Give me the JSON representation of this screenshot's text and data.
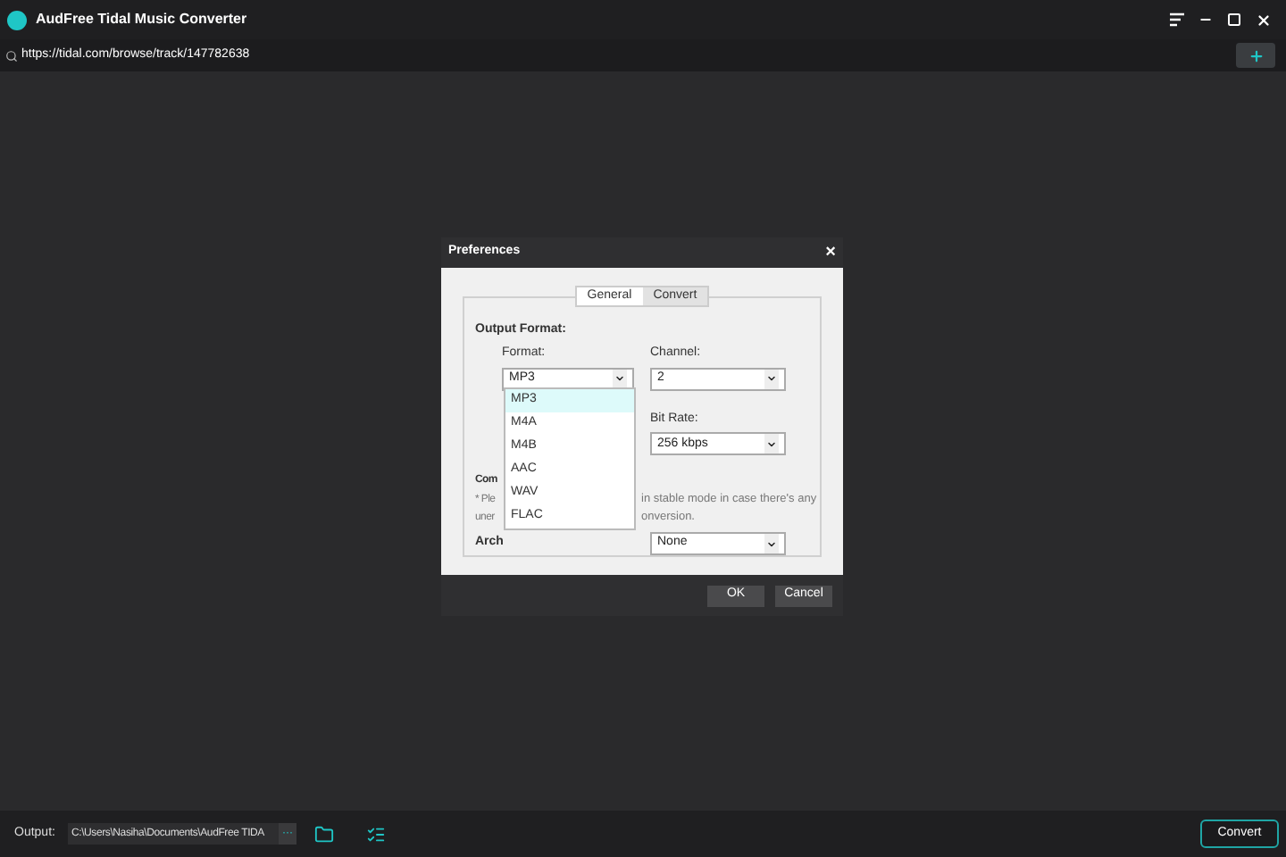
{
  "window": {
    "title": "AudFree Tidal Music Converter"
  },
  "address_bar": {
    "value": "https://tidal.com/browse/track/147782638"
  },
  "dialog": {
    "title": "Preferences",
    "close": "×",
    "tabs": [
      {
        "label": "General",
        "selected": false
      },
      {
        "label": "Convert",
        "selected": true
      }
    ],
    "section_heading": "Output Format:",
    "format": {
      "label": "Format:",
      "value": "MP3",
      "expanded": true,
      "options": [
        {
          "label": "MP3",
          "selected": true
        },
        {
          "label": "M4A",
          "selected": false
        },
        {
          "label": "M4B",
          "selected": false
        },
        {
          "label": "AAC",
          "selected": false
        },
        {
          "label": "WAV",
          "selected": false
        },
        {
          "label": "FLAC",
          "selected": false
        }
      ]
    },
    "channel": {
      "label": "Channel:",
      "value": "2"
    },
    "bit_rate": {
      "label": "Bit Rate:",
      "value": "256 kbps"
    },
    "compat_heading": "Com",
    "note_lines": [
      {
        "left": "* Ple",
        "right": "in stable mode in case there's any"
      },
      {
        "left": "uner",
        "right": "onversion."
      }
    ],
    "archive": {
      "label": "Arch",
      "value": "None"
    },
    "buttons": [
      "OK",
      "Cancel"
    ]
  },
  "bottom_bar": {
    "output_label": "Output:",
    "output_path": "C:\\Users\\Nasiha\\Documents\\AudFree TIDA",
    "browse": "···",
    "convert": "Convert"
  }
}
